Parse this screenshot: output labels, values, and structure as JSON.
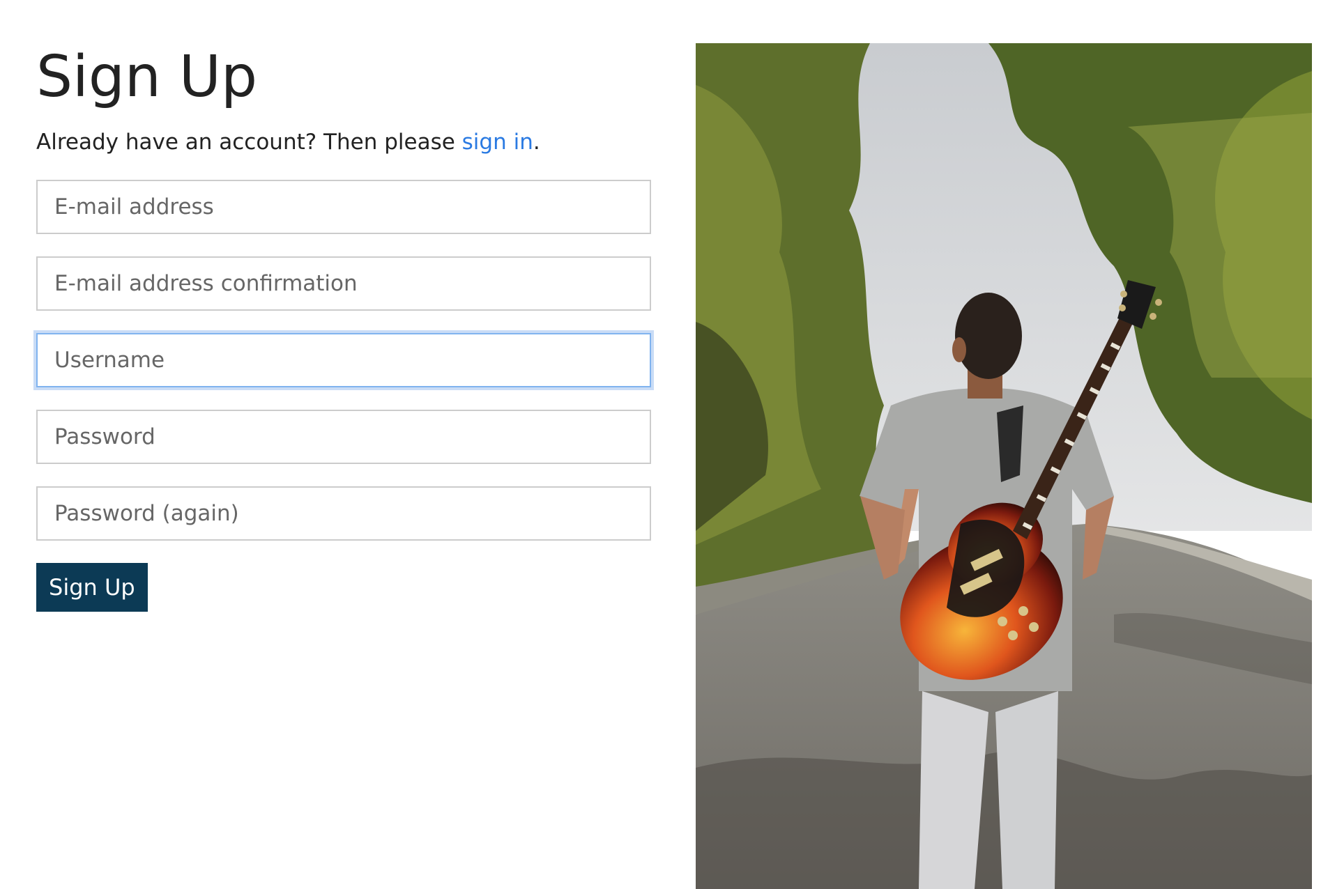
{
  "title": "Sign Up",
  "subtitle": {
    "prefix": "Already have an account? Then please ",
    "link_label": "sign in",
    "suffix": "."
  },
  "form": {
    "fields": [
      {
        "name": "email",
        "placeholder": "E-mail address",
        "value": ""
      },
      {
        "name": "email-confirmation",
        "placeholder": "E-mail address confirmation",
        "value": ""
      },
      {
        "name": "username",
        "placeholder": "Username",
        "value": "",
        "focused": true
      },
      {
        "name": "password",
        "placeholder": "Password",
        "value": ""
      },
      {
        "name": "password-again",
        "placeholder": "Password (again)",
        "value": ""
      }
    ],
    "submit_label": "Sign Up"
  },
  "colors": {
    "link": "#2a7ae2",
    "button_bg": "#0c3a55",
    "focus_ring": "#80b3ef"
  },
  "hero_image": {
    "description_icon": "photo-person-with-guitar-on-road"
  }
}
